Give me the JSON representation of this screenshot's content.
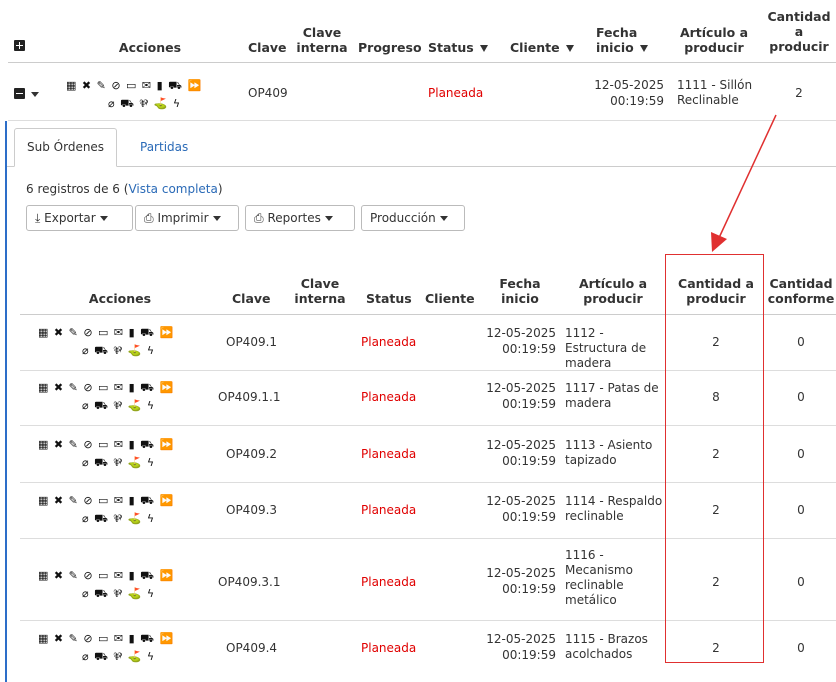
{
  "main_table": {
    "headers": {
      "acciones": "Acciones",
      "clave": "Clave",
      "clave_interna": "Clave interna",
      "progreso": "Progreso",
      "status": "Status",
      "cliente": "Cliente",
      "fecha_inicio": "Fecha inicio",
      "articulo": "Artículo a producir",
      "cantidad": "Cantidad a producir"
    },
    "row": {
      "clave": "OP409",
      "status": "Planeada",
      "fecha_date": "12-05-2025",
      "fecha_time": "00:19:59",
      "articulo": "1111 - Sillón Reclinable",
      "cantidad": "2"
    }
  },
  "action_icons_line1": "▦ ✖ ✎ ⊘ ▭ ✉ ▮ ⛟ ⏩",
  "action_icons_line2": "⌀ ⛟ ⅌ ⛳ ϟ",
  "tabs": [
    {
      "label": "Sub Órdenes",
      "active": true
    },
    {
      "label": "Partidas",
      "active": false
    }
  ],
  "records": {
    "prefix": "6 registros de 6 (",
    "link": "Vista completa",
    "suffix": ")"
  },
  "toolbar": {
    "exportar": "Exportar",
    "imprimir": "Imprimir",
    "reportes": "Reportes",
    "produccion": "Producción"
  },
  "sub_table": {
    "headers": {
      "acciones": "Acciones",
      "clave": "Clave",
      "clave_interna": "Clave interna",
      "status": "Status",
      "cliente": "Cliente",
      "fecha_inicio": "Fecha inicio",
      "articulo": "Artículo a producir",
      "cantidad": "Cantidad a producir",
      "conforme": "Cantidad conforme"
    },
    "rows": [
      {
        "clave": "OP409.1",
        "status": "Planeada",
        "date": "12-05-2025",
        "time": "00:19:59",
        "articulo": "1112 - Estructura de madera",
        "cantidad": "2",
        "conforme": "0"
      },
      {
        "clave": "OP409.1.1",
        "status": "Planeada",
        "date": "12-05-2025",
        "time": "00:19:59",
        "articulo": "1117 - Patas de madera",
        "cantidad": "8",
        "conforme": "0"
      },
      {
        "clave": "OP409.2",
        "status": "Planeada",
        "date": "12-05-2025",
        "time": "00:19:59",
        "articulo": "1113 - Asiento tapizado",
        "cantidad": "2",
        "conforme": "0"
      },
      {
        "clave": "OP409.3",
        "status": "Planeada",
        "date": "12-05-2025",
        "time": "00:19:59",
        "articulo": "1114 - Respaldo reclinable",
        "cantidad": "2",
        "conforme": "0"
      },
      {
        "clave": "OP409.3.1",
        "status": "Planeada",
        "date": "12-05-2025",
        "time": "00:19:59",
        "articulo": "1116 - Mecanismo reclinable metálico",
        "cantidad": "2",
        "conforme": "0"
      },
      {
        "clave": "OP409.4",
        "status": "Planeada",
        "date": "12-05-2025",
        "time": "00:19:59",
        "articulo": "1115 - Brazos acolchados",
        "cantidad": "2",
        "conforme": "0"
      }
    ]
  },
  "colors": {
    "status_red": "#e00000",
    "annotation_red": "#e03030",
    "link_blue": "#2a6ab7",
    "left_border_blue": "#2d6ec8"
  }
}
